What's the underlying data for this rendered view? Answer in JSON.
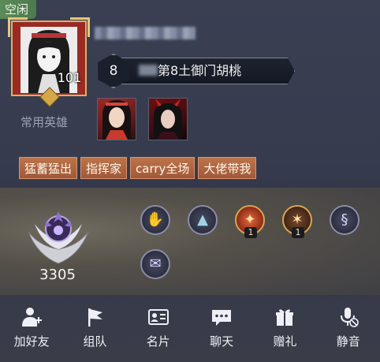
{
  "status": "空闲",
  "avatar": {
    "level": "101"
  },
  "rank": {
    "tier_number": "8",
    "title": "第8土御门胡桃"
  },
  "heroes": {
    "label": "常用英雄"
  },
  "tags": [
    "猛蓄猛出",
    "指挥家",
    "carry全场",
    "大佬带我"
  ],
  "score": "3305",
  "badges": [
    {
      "icon": "hero-hand-icon",
      "count": ""
    },
    {
      "icon": "triangle-gems-icon",
      "count": ""
    },
    {
      "icon": "mvp-flame-icon",
      "count": "1"
    },
    {
      "icon": "mvp-star-icon",
      "count": "1"
    },
    {
      "icon": "swirl-spirit-icon",
      "count": ""
    },
    {
      "icon": "scroll-icon",
      "count": ""
    }
  ],
  "actions": [
    {
      "label": "加好友",
      "icon": "add-friend-icon"
    },
    {
      "label": "组队",
      "icon": "flag-icon"
    },
    {
      "label": "名片",
      "icon": "card-icon"
    },
    {
      "label": "聊天",
      "icon": "chat-icon"
    },
    {
      "label": "赠礼",
      "icon": "gift-icon"
    },
    {
      "label": "静音",
      "icon": "mute-mic-icon"
    }
  ]
}
